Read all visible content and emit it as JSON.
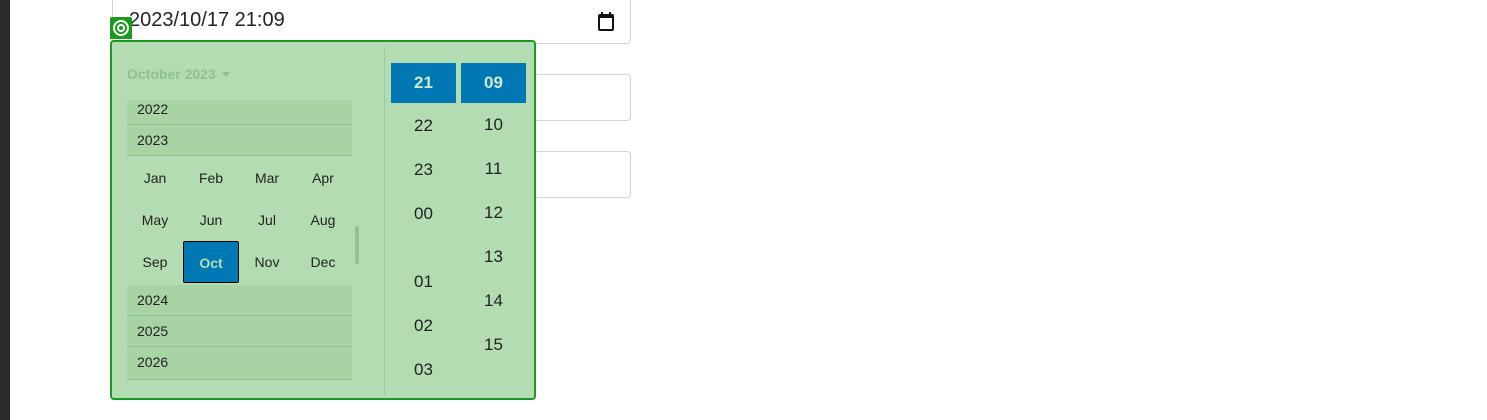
{
  "datetime_field": {
    "value": "2023/10/17 21:09",
    "icon": "calendar-icon"
  },
  "picker": {
    "badge_icon": "target-icon",
    "month_header": "October 2023",
    "years_before": [
      "2022",
      "2023"
    ],
    "months": [
      "Jan",
      "Feb",
      "Mar",
      "Apr",
      "May",
      "Jun",
      "Jul",
      "Aug",
      "Sep",
      "Oct",
      "Nov",
      "Dec"
    ],
    "selected_month": "Oct",
    "years_after": [
      "2024",
      "2025",
      "2026"
    ],
    "hours": [
      "21",
      "22",
      "23",
      "00",
      "01",
      "02",
      "03"
    ],
    "minutes": [
      "09",
      "10",
      "11",
      "12",
      "13",
      "14",
      "15"
    ],
    "selected_hour": "21",
    "selected_minute": "09"
  },
  "colors": {
    "picker_bg": "#b4dcb2",
    "picker_border": "#1a9a20",
    "selected_bg": "#0078b4"
  }
}
